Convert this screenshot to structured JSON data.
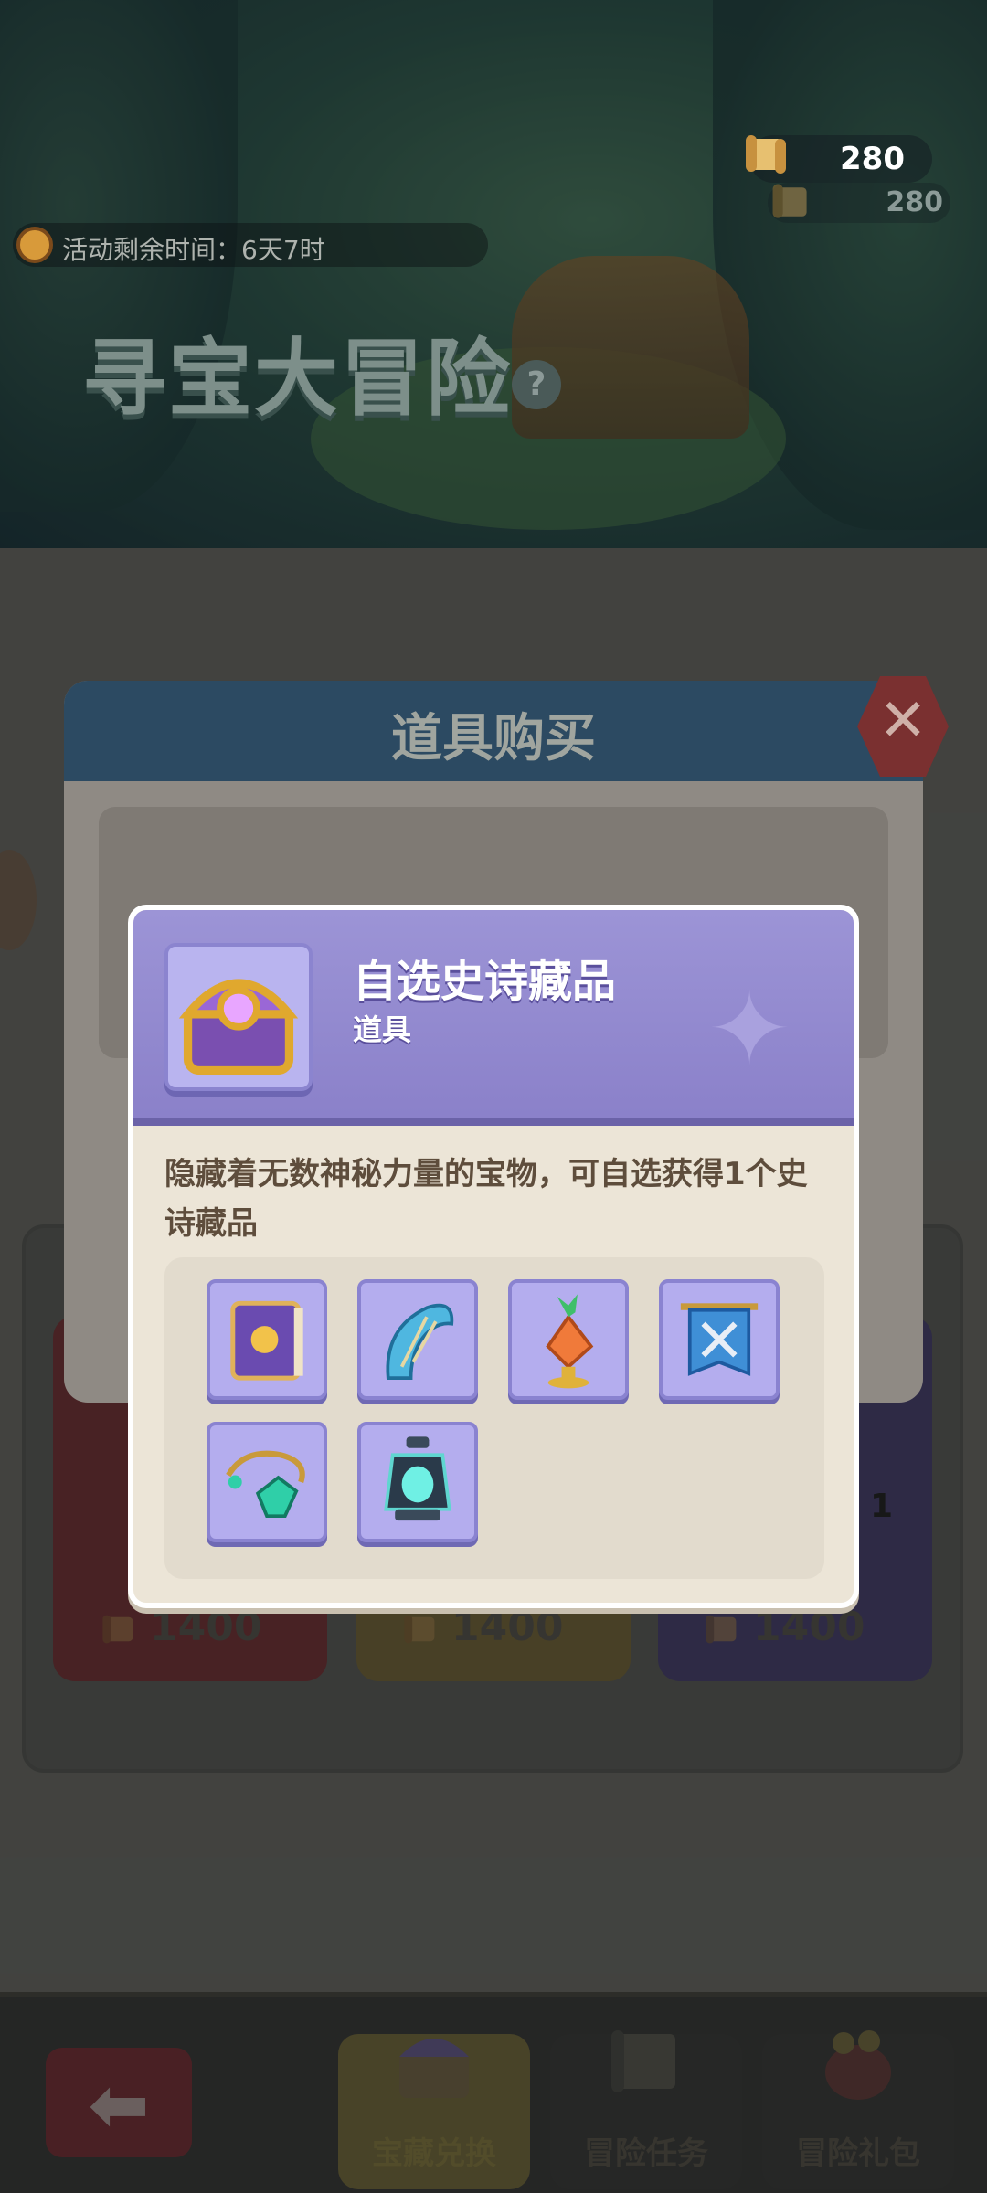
{
  "hud": {
    "currency_value": "280",
    "currency_secondary_value": "280",
    "timer_text": "活动剩余时间：6天7时",
    "event_title": "寻宝大冒险",
    "help_label": "?"
  },
  "purchase_dialog": {
    "title": "道具购买",
    "close_label": "✕"
  },
  "item_detail": {
    "name": "自选史诗藏品",
    "type": "道具",
    "description": "隐藏着无数神秘力量的宝物，可自选获得1个史诗藏品",
    "rewards": [
      {
        "icon": "spellbook-icon"
      },
      {
        "icon": "harp-icon"
      },
      {
        "icon": "crystal-carrot-icon"
      },
      {
        "icon": "crossed-swords-banner-icon"
      },
      {
        "icon": "gem-amulet-icon"
      },
      {
        "icon": "lantern-icon"
      }
    ]
  },
  "shop": {
    "prices": [
      "1400",
      "1400",
      "1400"
    ],
    "side_count": "1"
  },
  "bottom_nav": {
    "back_label": "⬅",
    "tabs": [
      {
        "label": "宝藏兑换",
        "active": true
      },
      {
        "label": "冒险任务",
        "active": false
      },
      {
        "label": "冒险礼包",
        "active": false
      }
    ]
  },
  "colors": {
    "popup_header": "#8a80c9",
    "popup_body": "#ece5d7",
    "reward_tile": "#b4adee",
    "close_button": "#7a3030"
  }
}
